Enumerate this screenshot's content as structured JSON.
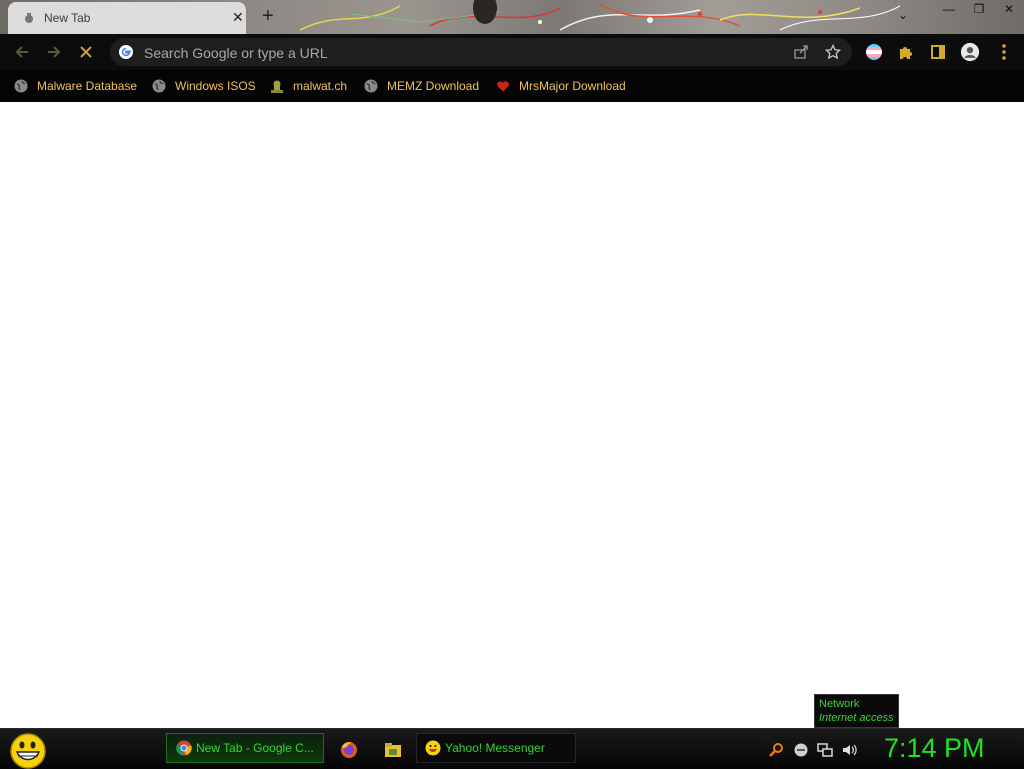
{
  "browser": {
    "tab_title": "New Tab",
    "close_tab_glyph": "✕",
    "new_tab_glyph": "+",
    "omnibox_placeholder": "Search Google or type a URL",
    "window_controls": {
      "minimize": "—",
      "restore": "❐",
      "close": "✕"
    }
  },
  "icons": {
    "back": "back-arrow-icon",
    "forward": "forward-arrow-icon",
    "stop": "stop-loading-icon",
    "google": "google-g-icon",
    "share": "share-icon",
    "bookmark": "star-icon",
    "extension_flag": "pride-flag-extension-icon",
    "extensions": "puzzle-icon",
    "side_panel": "side-panel-icon",
    "profile": "profile-avatar-icon",
    "menu": "kebab-menu-icon"
  },
  "bookmarks": [
    {
      "label": "Malware Database",
      "icon": "globe-icon"
    },
    {
      "label": "Windows ISOS",
      "icon": "globe-icon"
    },
    {
      "label": "malwat.ch",
      "icon": "skull-icon"
    },
    {
      "label": "MEMZ Download",
      "icon": "globe-icon"
    },
    {
      "label": "MrsMajor Download",
      "icon": "heart-icon"
    }
  ],
  "tooltip": {
    "title": "Network",
    "subtitle": "Internet access"
  },
  "taskbar": {
    "tasks": [
      {
        "label": "New Tab - Google C...",
        "icon": "chrome-icon",
        "active": true
      },
      {
        "label": "Yahoo! Messenger",
        "icon": "yahoo-smiley-icon",
        "active": false
      }
    ],
    "quick_launch": [
      "firefox-icon",
      "folder-icon"
    ],
    "tray": [
      "search-icon",
      "status-icon",
      "network-icon",
      "volume-icon"
    ],
    "clock": "7:14 PM"
  },
  "colors": {
    "bookmark_text": "#f3c25a",
    "taskbar_text": "#35d435",
    "clock": "#22e022",
    "toolbar_bg": "#0c0c0c"
  }
}
